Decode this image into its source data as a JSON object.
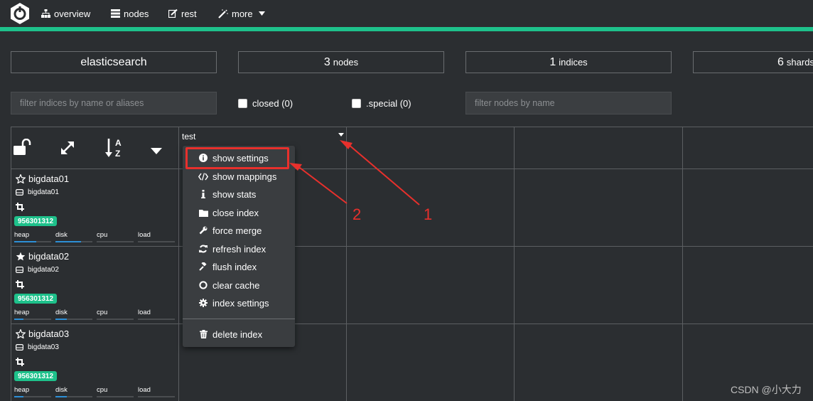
{
  "nav": {
    "items": [
      {
        "label": "overview",
        "icon": "sitemap-icon"
      },
      {
        "label": "nodes",
        "icon": "server-icon"
      },
      {
        "label": "rest",
        "icon": "edit-icon"
      },
      {
        "label": "more",
        "icon": "magic-wand-icon"
      }
    ]
  },
  "stats": {
    "cluster_name": "elasticsearch",
    "nodes_count": "3",
    "nodes_label": "nodes",
    "indices_count": "1",
    "indices_label": "indices",
    "shards_count": "6",
    "shards_label": "shards"
  },
  "filters": {
    "indices_placeholder": "filter indices by name or aliases",
    "closed_label": "closed (0)",
    "special_label": ".special (0)",
    "nodes_placeholder": "filter nodes by name"
  },
  "index": {
    "name": "test"
  },
  "nodes": [
    {
      "name": "bigdata01",
      "host": "bigdata01",
      "badge": "956301312",
      "master": false,
      "heap": 0.6,
      "disk": 0.7,
      "cpu": 0.0,
      "load": 0.0
    },
    {
      "name": "bigdata02",
      "host": "bigdata02",
      "badge": "956301312",
      "master": true,
      "heap": 0.25,
      "disk": 0.3,
      "cpu": 0.0,
      "load": 0.0
    },
    {
      "name": "bigdata03",
      "host": "bigdata03",
      "badge": "956301312",
      "master": false,
      "heap": 0.25,
      "disk": 0.3,
      "cpu": 0.0,
      "load": 0.0
    }
  ],
  "metrics": {
    "heap": "heap",
    "disk": "disk",
    "cpu": "cpu",
    "load": "load"
  },
  "menu": {
    "items": [
      {
        "label": "show settings",
        "icon": "info-circle-icon"
      },
      {
        "label": "show mappings",
        "icon": "code-icon"
      },
      {
        "label": "show stats",
        "icon": "info-icon"
      },
      {
        "label": "close index",
        "icon": "folder-icon"
      },
      {
        "label": "force merge",
        "icon": "wrench-icon"
      },
      {
        "label": "refresh index",
        "icon": "refresh-icon"
      },
      {
        "label": "flush index",
        "icon": "gavel-icon"
      },
      {
        "label": "clear cache",
        "icon": "circle-icon"
      },
      {
        "label": "index settings",
        "icon": "gear-icon"
      }
    ],
    "delete_label": "delete index"
  },
  "annotations": {
    "one": "1",
    "two": "2"
  },
  "watermark": "CSDN @小大力",
  "colors": {
    "accent": "#1ec18b",
    "annotation": "#e8302c",
    "background": "#2b2e31"
  }
}
